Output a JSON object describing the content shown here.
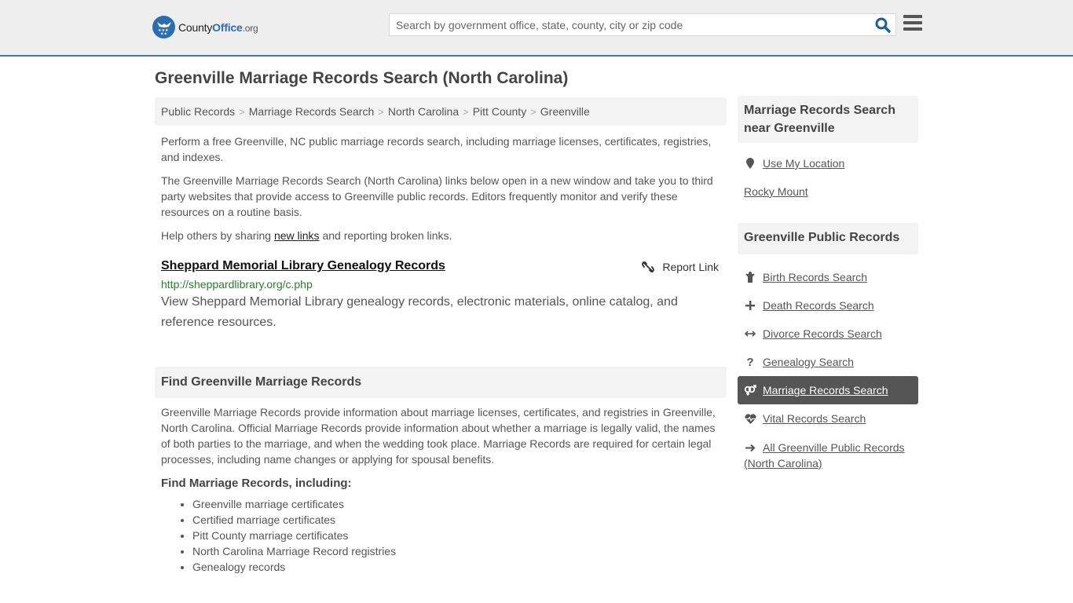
{
  "header": {
    "logo": {
      "brand_prefix": "County",
      "brand_main": "Office",
      "brand_suffix": ".org"
    },
    "search": {
      "placeholder": "Search by government office, state, county, city or zip code",
      "value": ""
    },
    "icons": {
      "search": "search-icon",
      "menu": "hamburger-menu-icon"
    },
    "accent_color": "#3a7bab"
  },
  "page": {
    "title": "Greenville Marriage Records Search (North Carolina)"
  },
  "breadcrumb": [
    {
      "label": "Public Records"
    },
    {
      "label": "Marriage Records Search"
    },
    {
      "label": "North Carolina"
    },
    {
      "label": "Pitt County"
    },
    {
      "label": "Greenville"
    }
  ],
  "intro": {
    "p1": "Perform a free Greenville, NC public marriage records search, including marriage licenses, certificates, registries, and indexes.",
    "p2": "The Greenville Marriage Records Search (North Carolina) links below open in a new window and take you to third party websites that provide access to Greenville public records. Editors frequently monitor and verify these resources on a routine basis.",
    "p3_before": "Help others by sharing ",
    "p3_link": "new links",
    "p3_after": " and reporting broken links."
  },
  "results": [
    {
      "title": "Sheppard Memorial Library Genealogy Records",
      "url": "http://sheppardlibrary.org/c.php",
      "description": "View Sheppard Memorial Library genealogy records, electronic materials, online catalog, and reference resources.",
      "report_label": "Report Link",
      "url_color": "#2e7d32"
    }
  ],
  "find_section": {
    "heading": "Find Greenville Marriage Records",
    "body": "Greenville Marriage Records provide information about marriage licenses, certificates, and registries in Greenville, North Carolina. Official Marriage Records provide information about whether a marriage is legally valid, the names of both parties to the marriage, and when the wedding took place. Marriage Records are required for certain legal processes, including name changes or applying for spousal benefits.",
    "subheading": "Find Marriage Records, including:",
    "items": [
      "Greenville marriage certificates",
      "Certified marriage certificates",
      "Pitt County marriage certificates",
      "North Carolina Marriage Record registries",
      "Genealogy records"
    ]
  },
  "sidebar": {
    "nearby": {
      "heading": "Marriage Records Search near Greenville",
      "use_location": "Use My Location",
      "places": [
        "Rocky Mount"
      ]
    },
    "public_records": {
      "heading": "Greenville Public Records",
      "items": [
        {
          "label": "Birth Records Search",
          "icon": "child-icon",
          "active": false
        },
        {
          "label": "Death Records Search",
          "icon": "plus-icon",
          "active": false
        },
        {
          "label": "Divorce Records Search",
          "icon": "arrows-horizontal-icon",
          "active": false
        },
        {
          "label": "Genealogy Search",
          "icon": "question-icon",
          "active": false
        },
        {
          "label": "Marriage Records Search",
          "icon": "venus-mars-icon",
          "active": true
        },
        {
          "label": "Vital Records Search",
          "icon": "heartbeat-icon",
          "active": false
        },
        {
          "label": "All Greenville Public Records (North Carolina)",
          "icon": "arrow-right-icon",
          "active": false
        }
      ]
    }
  }
}
